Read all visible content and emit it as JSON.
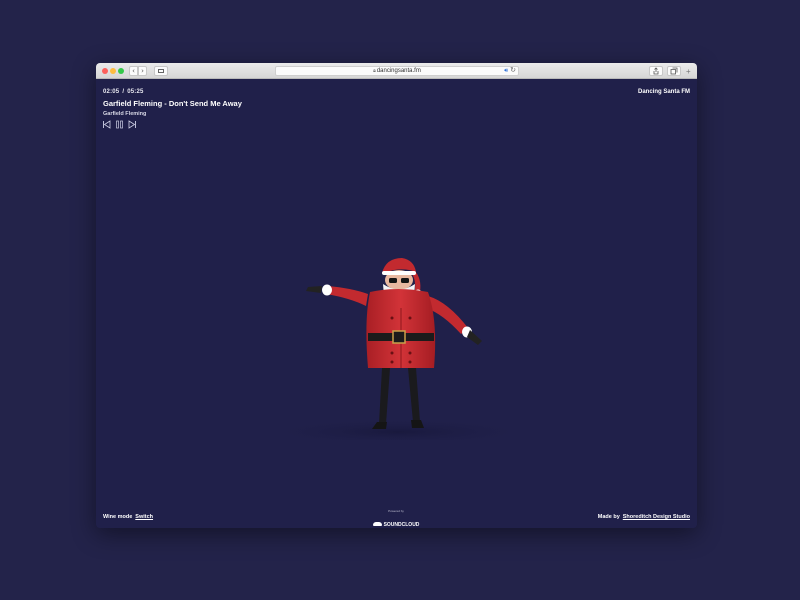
{
  "browser": {
    "url": "dancingsanta.fm",
    "back_glyph": "‹",
    "forward_glyph": "›",
    "plus_glyph": "+"
  },
  "player": {
    "elapsed": "02:05",
    "separator": "/",
    "duration": "05:25",
    "track_title": "Garfield Fleming - Don't Send Me Away",
    "artist": "Garfield Fleming"
  },
  "header": {
    "site_name": "Dancing Santa FM"
  },
  "footer": {
    "wine_mode_label": "Wine mode",
    "switch_label": "Switch",
    "powered_by": "Powered by",
    "soundcloud": "SOUNDCLOUD",
    "made_by_label": "Made by",
    "studio_link": "Shoreditch Design Studio"
  },
  "colors": {
    "page_background": "#23234a",
    "app_background": "#20204a",
    "santa_red": "#c62a2e",
    "link_blue": "#2b6fd8"
  },
  "icons": [
    "lock-icon",
    "speaker-icon",
    "reload-icon",
    "sidebar-icon",
    "share-icon",
    "tabs-icon",
    "previous-icon",
    "pause-icon",
    "next-icon",
    "soundcloud-icon"
  ]
}
